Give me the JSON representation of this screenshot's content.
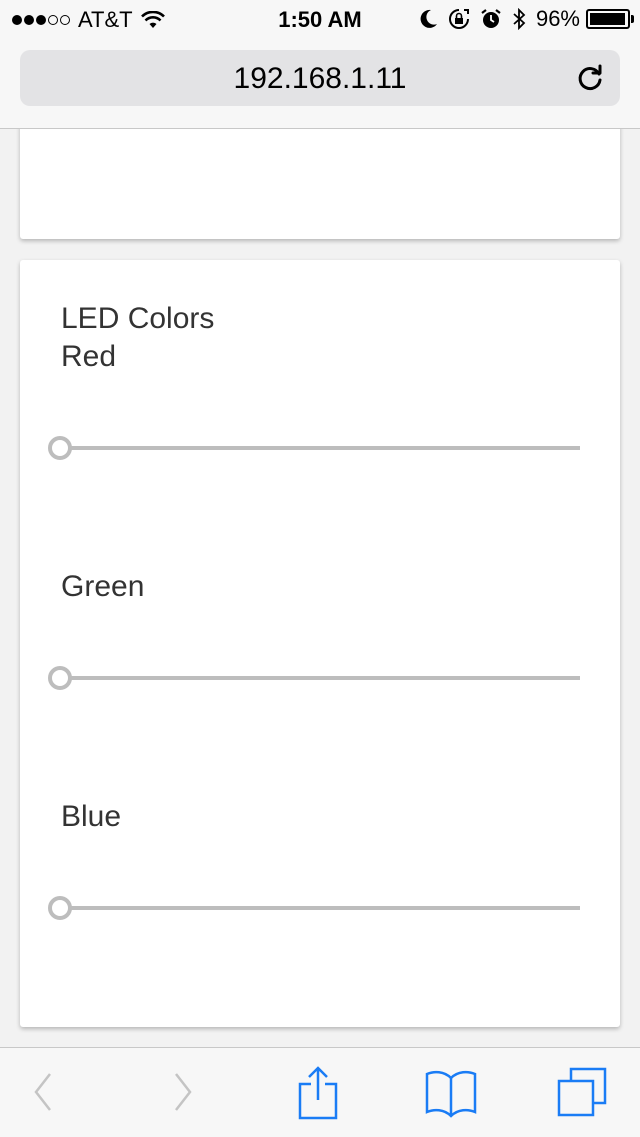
{
  "status_bar": {
    "signal_dots_filled": 3,
    "signal_dots_total": 5,
    "carrier": "AT&T",
    "time": "1:50 AM",
    "battery_percent": "96%",
    "battery_level": 0.96,
    "icons": [
      "wifi-icon",
      "moon-icon",
      "rotation-lock-icon",
      "alarm-icon",
      "bluetooth-icon",
      "battery-icon"
    ]
  },
  "url_bar": {
    "address": "192.168.1.11",
    "reload_icon": "reload-icon"
  },
  "led_card": {
    "title": "LED Colors",
    "sliders": [
      {
        "label": "Red",
        "value": 0
      },
      {
        "label": "Green",
        "value": 0
      },
      {
        "label": "Blue",
        "value": 0
      }
    ]
  },
  "toolbar": {
    "buttons": [
      "back-icon",
      "forward-icon",
      "share-icon",
      "bookmarks-icon",
      "tabs-icon"
    ],
    "accent_color": "#1a7cf5",
    "disabled_color": "#c4c4c4"
  },
  "colors": {
    "background": "#f2f2f2",
    "card": "#ffffff",
    "slider_track": "#bdbdbd",
    "text": "#333333"
  }
}
